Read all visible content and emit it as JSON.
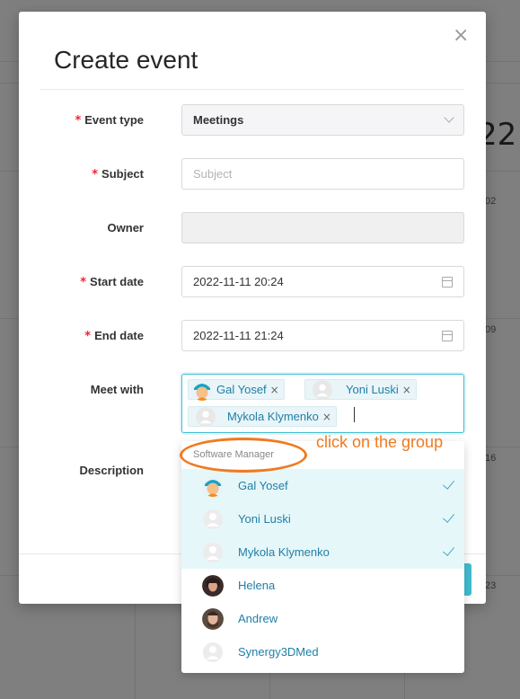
{
  "background": {
    "title_fragment": "22",
    "day_numbers": [
      "02",
      "09",
      "16",
      "23"
    ]
  },
  "modal": {
    "title": "Create event",
    "close_glyph": "×",
    "fields": {
      "event_type": {
        "label": "Event type",
        "required": true,
        "value": "Meetings"
      },
      "subject": {
        "label": "Subject",
        "required": true,
        "placeholder": "Subject",
        "value": ""
      },
      "owner": {
        "label": "Owner",
        "required": false,
        "value": ""
      },
      "start_date": {
        "label": "Start date",
        "required": true,
        "value": "2022-11-11 20:24"
      },
      "end_date": {
        "label": "End date",
        "required": true,
        "value": "2022-11-11 21:24"
      },
      "meet_with": {
        "label": "Meet with",
        "required": false,
        "selected": [
          {
            "name": "Gal Yosef",
            "avatar": "cartoon-avatar"
          },
          {
            "name": "Yoni Luski",
            "avatar": "default-avatar"
          },
          {
            "name": "Mykola Klymenko",
            "avatar": "default-avatar"
          }
        ]
      },
      "description": {
        "label": "Description",
        "required": false
      }
    },
    "required_marker": "*"
  },
  "dropdown": {
    "group_label": "Software Manager",
    "options": [
      {
        "name": "Gal Yosef",
        "avatar": "cartoon-avatar",
        "selected": true
      },
      {
        "name": "Yoni Luski",
        "avatar": "default-avatar",
        "selected": true
      },
      {
        "name": "Mykola Klymenko",
        "avatar": "default-avatar",
        "selected": true
      },
      {
        "name": "Helena",
        "avatar": "photo-avatar",
        "selected": false
      },
      {
        "name": "Andrew",
        "avatar": "photo-avatar",
        "selected": false
      },
      {
        "name": "Synergy3DMed",
        "avatar": "default-avatar",
        "selected": false
      }
    ]
  },
  "annotation": {
    "text": "click on the group",
    "color": "#f07a1f"
  },
  "colors": {
    "accent": "#40bcd0",
    "link": "#1f7fa6",
    "required": "#f5222d"
  }
}
